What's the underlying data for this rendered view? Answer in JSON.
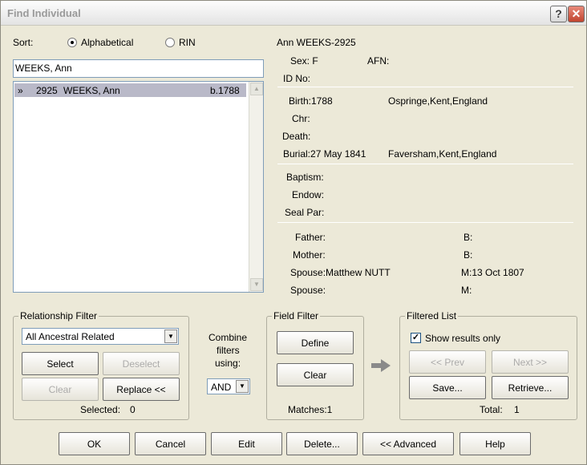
{
  "window": {
    "title": "Find Individual"
  },
  "sort": {
    "label": "Sort:",
    "options": [
      "Alphabetical",
      "RIN"
    ],
    "selected": "Alphabetical"
  },
  "search": {
    "value": "WEEKS, Ann"
  },
  "results": [
    {
      "marker": "»",
      "rin": "2925",
      "name": "WEEKS, Ann",
      "date": "b.1788"
    }
  ],
  "details": {
    "heading": "Ann WEEKS-2925",
    "sex": "Sex: F",
    "afn": "AFN:",
    "id_no": "ID No:",
    "birth": "Birth:1788",
    "birth_place": "Ospringe,Kent,England",
    "chr": "Chr:",
    "death": "Death:",
    "burial": "Burial:27 May 1841",
    "burial_place": "Faversham,Kent,England",
    "baptism": "Baptism:",
    "endow": "Endow:",
    "seal_par": "Seal Par:",
    "father": "Father:",
    "father_b": "B:",
    "mother": "Mother:",
    "mother_b": "B:",
    "spouse1": "Spouse:Matthew NUTT",
    "spouse1_m": "M:13 Oct 1807",
    "spouse2": "Spouse:",
    "spouse2_m": "M:"
  },
  "relationship_filter": {
    "title": "Relationship Filter",
    "selected": "All Ancestral Related",
    "select": "Select",
    "deselect": "Deselect",
    "clear": "Clear",
    "replace": "Replace <<",
    "selected_label": "Selected:",
    "selected_count": "0"
  },
  "combine": {
    "line1": "Combine",
    "line2": "filters",
    "line3": "using:",
    "value": "AND"
  },
  "field_filter": {
    "title": "Field Filter",
    "define": "Define",
    "clear": "Clear",
    "matches": "Matches:1"
  },
  "filtered_list": {
    "title": "Filtered List",
    "show_results": "Show results only",
    "prev": "<< Prev",
    "next": "Next >>",
    "save": "Save...",
    "retrieve": "Retrieve...",
    "total_label": "Total:",
    "total": "1"
  },
  "buttons": {
    "ok": "OK",
    "cancel": "Cancel",
    "edit": "Edit",
    "delete": "Delete...",
    "advanced": "<< Advanced",
    "help": "Help"
  }
}
